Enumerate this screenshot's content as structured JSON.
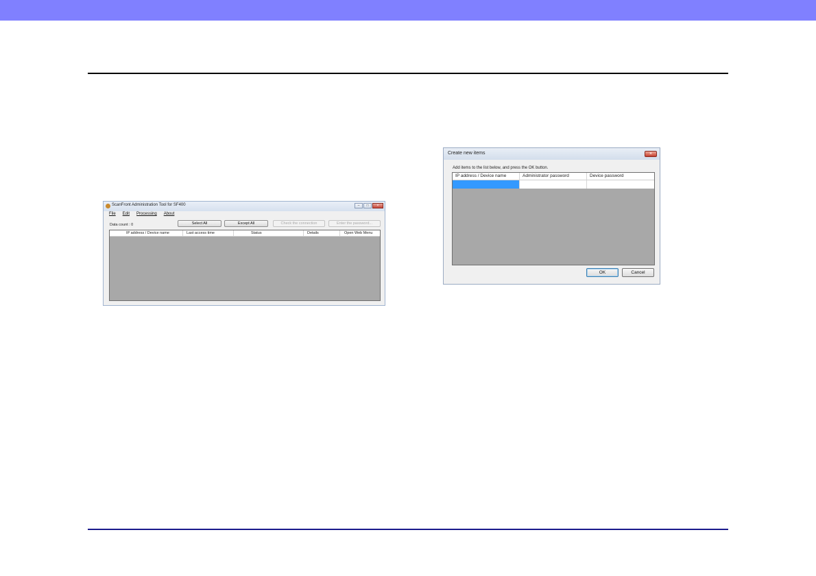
{
  "main_window": {
    "title": "ScanFront Administration Tool for SF400",
    "window_controls": [
      "–",
      "□",
      "×"
    ],
    "menu": [
      "File",
      "Edit",
      "Processing",
      "About"
    ],
    "data_count": "Data count : 0",
    "toolbar": {
      "select_all": "Select All",
      "except_all": "Except All",
      "check_connection": "Check the connection",
      "enter_password": "Enter the password..."
    },
    "columns": [
      "IP address / Device name",
      "Last access time",
      "Status",
      "Details",
      "Open Web Menu"
    ]
  },
  "dialog": {
    "title": "Create new items",
    "close": "×",
    "instruction": "Add items to the list below, and press the OK button.",
    "columns": [
      "IP address / Device name",
      "Administrator password",
      "Device password"
    ],
    "ok": "OK",
    "cancel": "Cancel"
  }
}
